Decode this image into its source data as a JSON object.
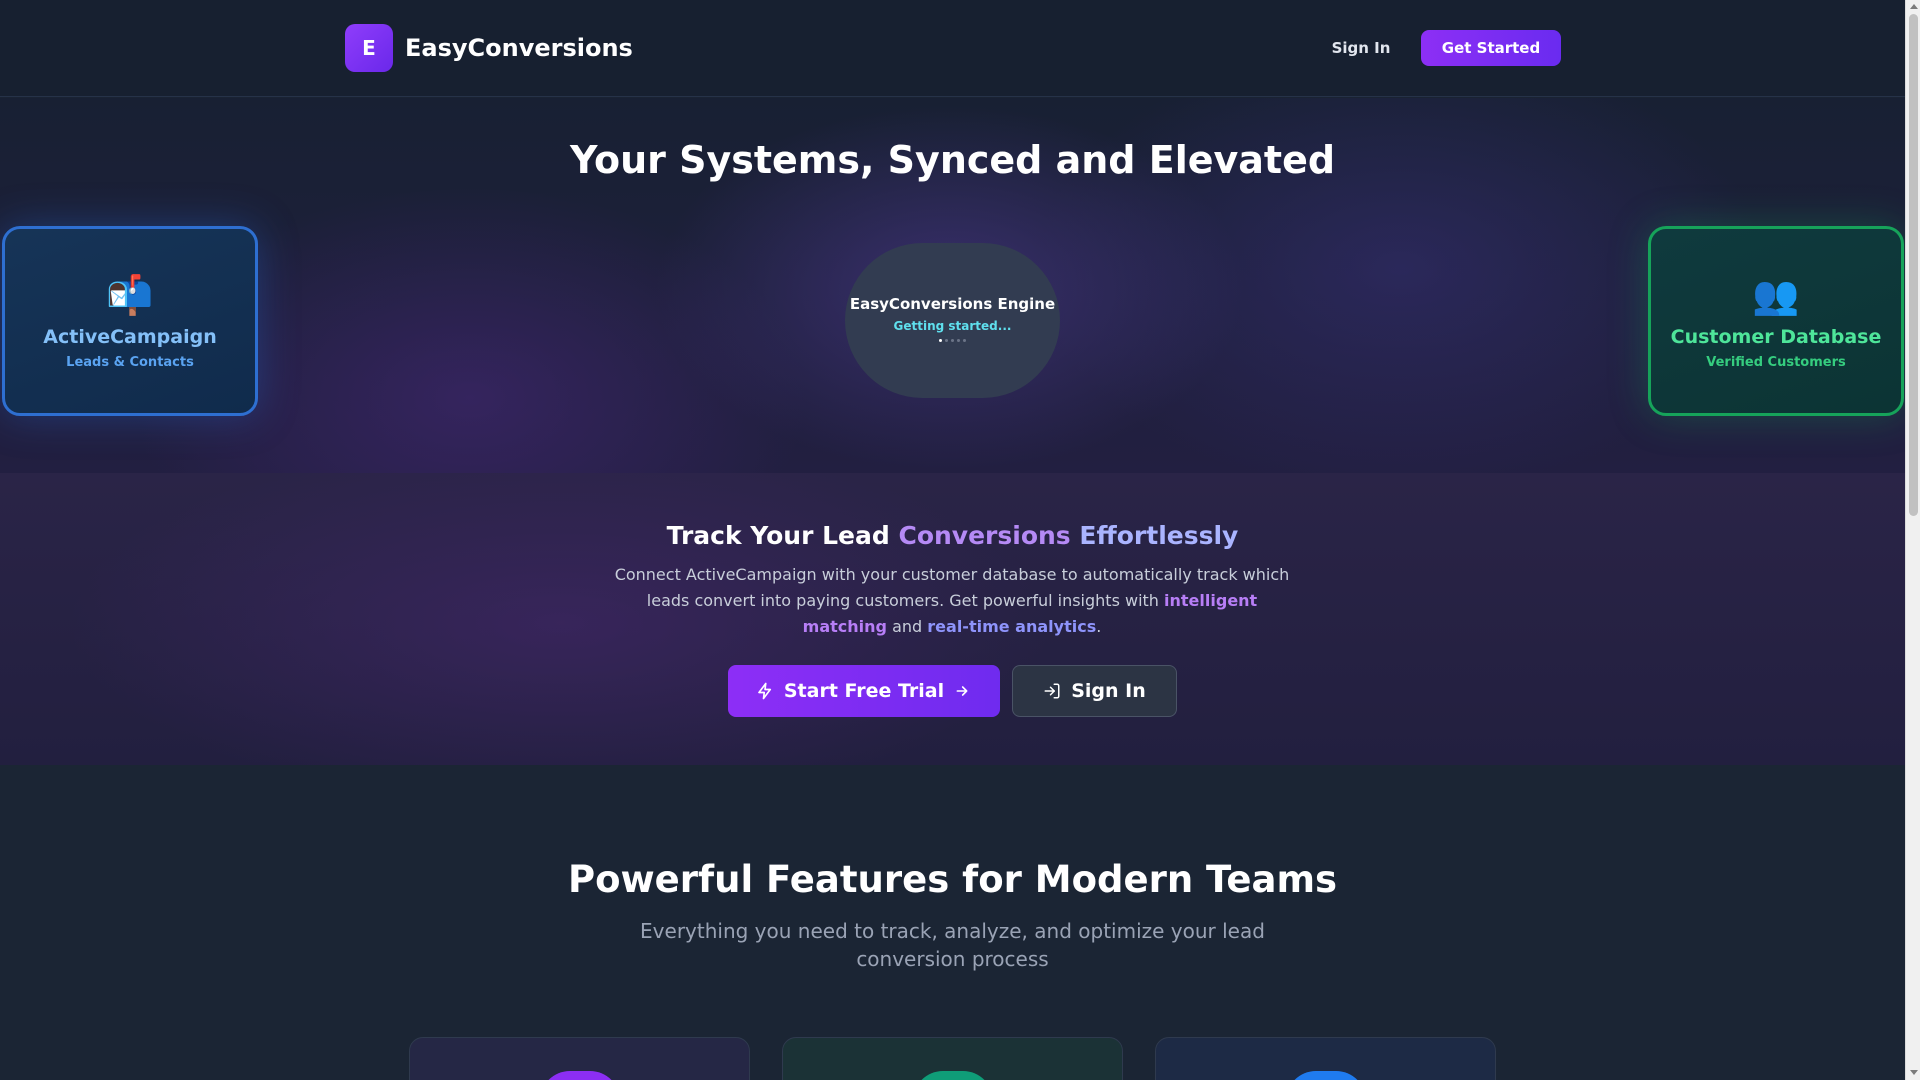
{
  "header": {
    "logo_letter": "E",
    "brand_name": "EasyConversions",
    "sign_in_label": "Sign In",
    "get_started_label": "Get Started"
  },
  "hero": {
    "title": "Your Systems, Synced and Elevated",
    "left_node": {
      "icon": "📬",
      "icon_name": "mailbox-icon",
      "title": "ActiveCampaign",
      "subtitle": "Leads & Contacts"
    },
    "engine": {
      "title": "EasyConversions Engine",
      "status": "Getting started..."
    },
    "right_node": {
      "icon": "👥",
      "icon_name": "users-icon",
      "title": "Customer Database",
      "subtitle": "Verified Customers"
    }
  },
  "cta": {
    "title_part1": "Track Your Lead ",
    "title_accent1": "Conversions",
    "title_part2": " ",
    "title_accent2": "Effortlessly",
    "desc_part1": "Connect ActiveCampaign with your customer database to automatically track which leads convert into paying customers. Get powerful insights with ",
    "desc_highlight1": "intelligent matching",
    "desc_part2": " and ",
    "desc_highlight2": "real-time analytics",
    "desc_part3": ".",
    "trial_label": "Start Free Trial",
    "signin_label": "Sign In"
  },
  "features": {
    "title": "Powerful Features for Modern Teams",
    "subtitle": "Everything you need to track, analyze, and optimize your lead conversion process"
  },
  "colors": {
    "accent_purple": "#8d2ef6",
    "accent_blue": "#2e6fd1",
    "accent_green": "#16a35a"
  }
}
